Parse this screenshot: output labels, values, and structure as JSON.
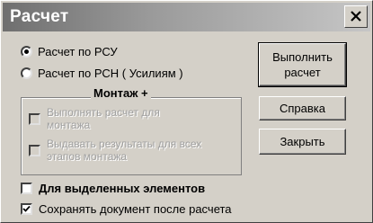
{
  "dialog": {
    "title": "Расчет"
  },
  "options": {
    "radio_rsu": "Расчет по РСУ",
    "radio_rsn": "Расчет по РСН ( Усилиям )",
    "rsu_selected": true
  },
  "montazh_group": {
    "title": "Монтаж +",
    "check1": "Выполнять расчет для монтажа",
    "check2": "Выдавать результаты для всех этапов монтажа"
  },
  "checks": {
    "selected_elements": "Для выделенных элементов",
    "selected_elements_checked": false,
    "save_document": "Сохранять документ после расчета",
    "save_document_checked": true
  },
  "buttons": {
    "run_line1": "Выполнить",
    "run_line2": "расчет",
    "help": "Справка",
    "close": "Закрыть"
  }
}
